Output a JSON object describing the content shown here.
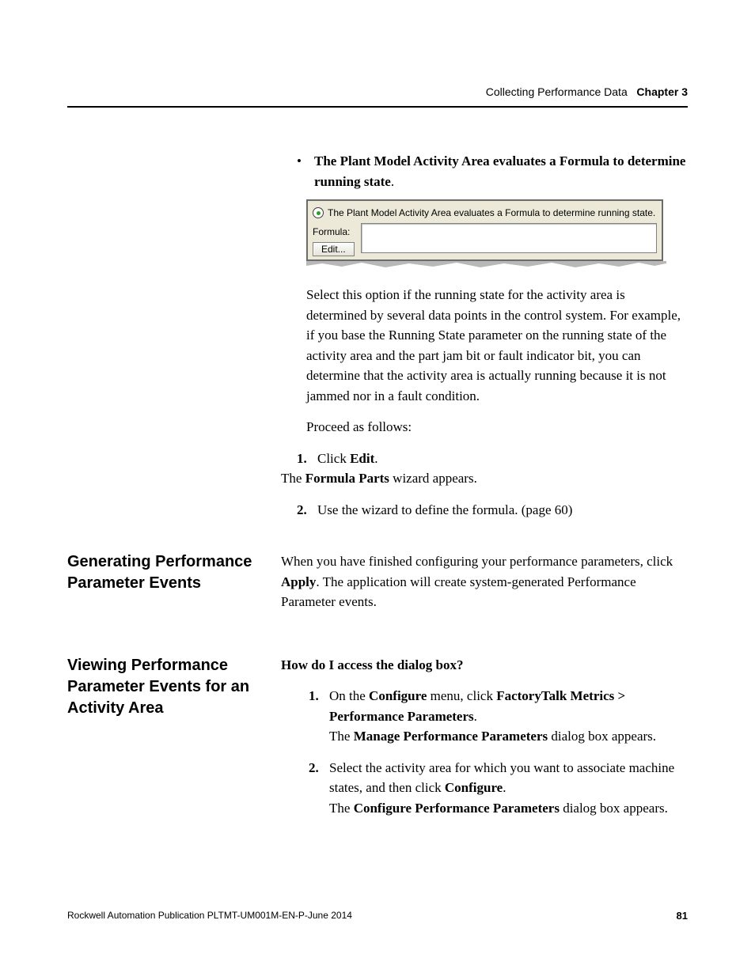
{
  "header": {
    "section": "Collecting Performance Data",
    "chapter": "Chapter 3"
  },
  "bullet1": {
    "pre": "The Plant Model Activity Area evaluates a Formula to determine running state",
    "post": "."
  },
  "screenshot": {
    "radio_label": "The Plant Model Activity Area evaluates a Formula to determine running state.",
    "formula_label": "Formula:",
    "edit_button": "Edit...",
    "formula_value": ""
  },
  "p1": "Select this option if the running state for the activity area is determined by several data points in the control system. For example, if you base the Running State parameter on the running state of the activity area and the part jam bit or fault indicator bit, you can determine that the activity area is actually running because it is not jammed nor in a fault condition.",
  "p2": "Proceed as follows:",
  "step1": {
    "pre": "Click ",
    "bold": "Edit",
    "post": "."
  },
  "step1_result": {
    "pre": "The ",
    "bold": "Formula Parts",
    "post": " wizard appears."
  },
  "step2": "Use the wizard to define the formula. (page 60)",
  "sec_gen": {
    "title": "Generating Performance Parameter Events",
    "p_pre": "When you have finished configuring your performance parameters, click ",
    "p_bold": "Apply",
    "p_post": ". The application will create system-generated Performance Parameter events."
  },
  "sec_view": {
    "title": "Viewing Performance Parameter Events for an Activity Area",
    "q": "How do I access the dialog box?",
    "s1_pre": "On the ",
    "s1_b1": "Configure",
    "s1_mid": " menu, click ",
    "s1_b2": "FactoryTalk Metrics > Performance Parameters",
    "s1_post": ".",
    "s1_res_pre": "The ",
    "s1_res_b": "Manage Performance Parameters",
    "s1_res_post": " dialog box appears.",
    "s2_pre": "Select the activity area for which you want to associate machine states, and then click ",
    "s2_b": "Configure",
    "s2_post": ".",
    "s2_res_pre": "The ",
    "s2_res_b": "Configure Performance Parameters",
    "s2_res_post": " dialog box appears."
  },
  "footer": {
    "pub": "Rockwell Automation Publication PLTMT-UM001M-EN-P-June 2014",
    "page": "81"
  },
  "nums": {
    "one": "1.",
    "two": "2."
  },
  "bullet_glyph": "•"
}
